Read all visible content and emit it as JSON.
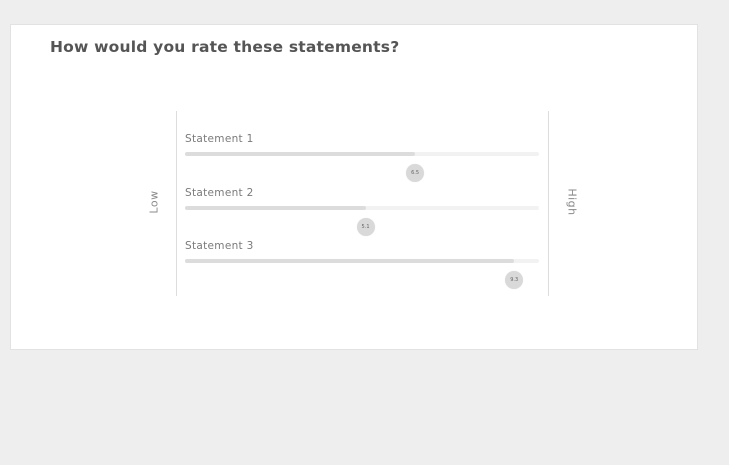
{
  "question": "How would you rate these statements?",
  "scale": {
    "low_label": "Low",
    "high_label": "High",
    "min": 0,
    "max": 10
  },
  "statements": [
    {
      "label": "Statement 1",
      "value": 6.5,
      "value_text": "6.5"
    },
    {
      "label": "Statement 2",
      "value": 5.1,
      "value_text": "5.1"
    },
    {
      "label": "Statement 3",
      "value": 9.3,
      "value_text": "9.3"
    }
  ],
  "colors": {
    "page_background": "#eeeeee",
    "card_background": "#ffffff",
    "track": "#f2f2f2",
    "fill": "#dcdcdc",
    "thumb": "#d9d9d9"
  }
}
